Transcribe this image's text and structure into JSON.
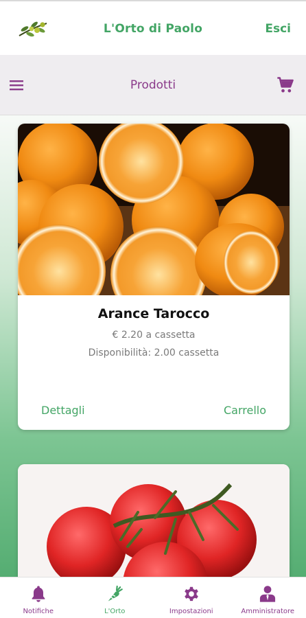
{
  "header": {
    "app_title": "L'Orto di Paolo",
    "logout_label": "Esci"
  },
  "subheader": {
    "section_title": "Prodotti"
  },
  "products": [
    {
      "name": "Arance Tarocco",
      "price": "€ 2.20 a cassetta",
      "availability": "Disponibilità: 2.00 cassetta",
      "details_label": "Dettagli",
      "cart_label": "Carrello"
    }
  ],
  "bottom_nav": [
    {
      "label": "Notifiche",
      "icon": "bell-icon",
      "active": false
    },
    {
      "label": "L'Orto",
      "icon": "carrot-icon",
      "active": true
    },
    {
      "label": "Impostazioni",
      "icon": "gear-icon",
      "active": false
    },
    {
      "label": "Amministratore",
      "icon": "admin-icon",
      "active": false
    }
  ],
  "colors": {
    "primary_green": "#43a565",
    "primary_purple": "#8a3a8a"
  }
}
